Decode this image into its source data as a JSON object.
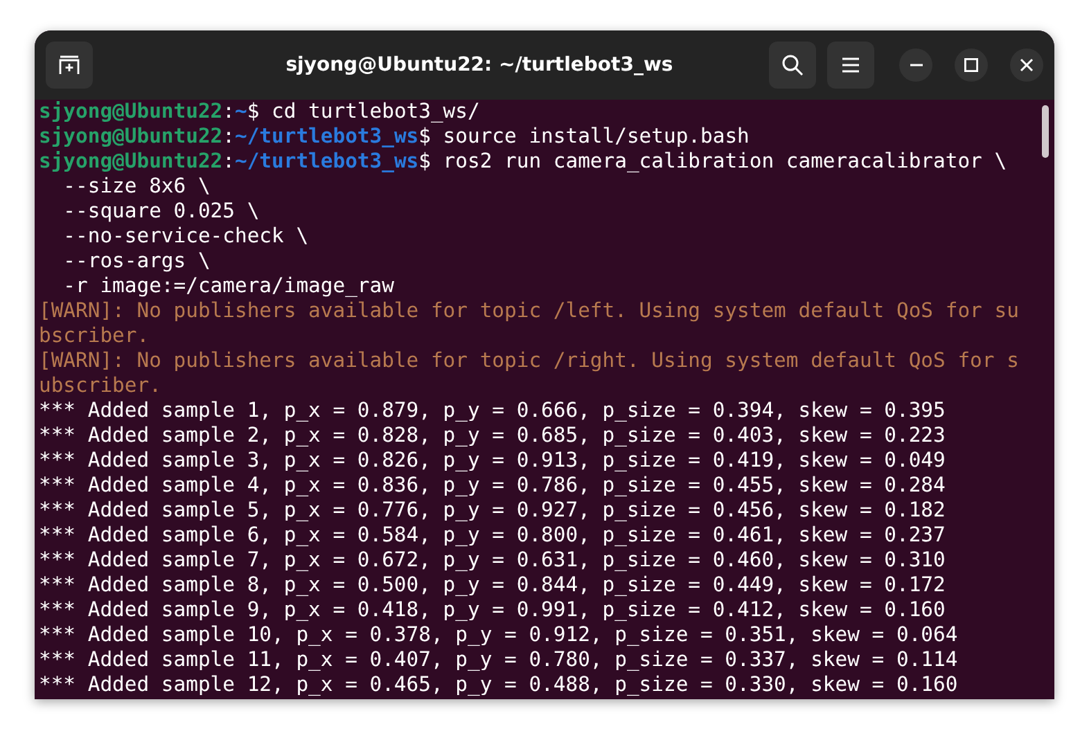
{
  "window": {
    "title": "sjyong@Ubuntu22: ~/turtlebot3_ws"
  },
  "terminal": {
    "lines": [
      {
        "kind": "prompt",
        "user": "sjyong@Ubuntu22",
        "sep": ":",
        "path": "~",
        "command": "$ cd turtlebot3_ws/"
      },
      {
        "kind": "prompt",
        "user": "sjyong@Ubuntu22",
        "sep": ":",
        "path": "~/turtlebot3_ws",
        "command": "$ source install/setup.bash"
      },
      {
        "kind": "prompt",
        "user": "sjyong@Ubuntu22",
        "sep": ":",
        "path": "~/turtlebot3_ws",
        "command": "$ ros2 run camera_calibration cameracalibrator \\"
      },
      {
        "kind": "output",
        "text": "  --size 8x6 \\"
      },
      {
        "kind": "output",
        "text": "  --square 0.025 \\"
      },
      {
        "kind": "output",
        "text": "  --no-service-check \\"
      },
      {
        "kind": "output",
        "text": "  --ros-args \\"
      },
      {
        "kind": "output",
        "text": "  -r image:=/camera/image_raw"
      },
      {
        "kind": "warn",
        "text": "[WARN]: No publishers available for topic /left. Using system default QoS for su"
      },
      {
        "kind": "warn",
        "text": "bscriber."
      },
      {
        "kind": "warn",
        "text": "[WARN]: No publishers available for topic /right. Using system default QoS for s"
      },
      {
        "kind": "warn",
        "text": "ubscriber."
      },
      {
        "kind": "output",
        "text": "*** Added sample 1, p_x = 0.879, p_y = 0.666, p_size = 0.394, skew = 0.395"
      },
      {
        "kind": "output",
        "text": "*** Added sample 2, p_x = 0.828, p_y = 0.685, p_size = 0.403, skew = 0.223"
      },
      {
        "kind": "output",
        "text": "*** Added sample 3, p_x = 0.826, p_y = 0.913, p_size = 0.419, skew = 0.049"
      },
      {
        "kind": "output",
        "text": "*** Added sample 4, p_x = 0.836, p_y = 0.786, p_size = 0.455, skew = 0.284"
      },
      {
        "kind": "output",
        "text": "*** Added sample 5, p_x = 0.776, p_y = 0.927, p_size = 0.456, skew = 0.182"
      },
      {
        "kind": "output",
        "text": "*** Added sample 6, p_x = 0.584, p_y = 0.800, p_size = 0.461, skew = 0.237"
      },
      {
        "kind": "output",
        "text": "*** Added sample 7, p_x = 0.672, p_y = 0.631, p_size = 0.460, skew = 0.310"
      },
      {
        "kind": "output",
        "text": "*** Added sample 8, p_x = 0.500, p_y = 0.844, p_size = 0.449, skew = 0.172"
      },
      {
        "kind": "output",
        "text": "*** Added sample 9, p_x = 0.418, p_y = 0.991, p_size = 0.412, skew = 0.160"
      },
      {
        "kind": "output",
        "text": "*** Added sample 10, p_x = 0.378, p_y = 0.912, p_size = 0.351, skew = 0.064"
      },
      {
        "kind": "output",
        "text": "*** Added sample 11, p_x = 0.407, p_y = 0.780, p_size = 0.337, skew = 0.114"
      },
      {
        "kind": "output",
        "text": "*** Added sample 12, p_x = 0.465, p_y = 0.488, p_size = 0.330, skew = 0.160"
      }
    ]
  }
}
